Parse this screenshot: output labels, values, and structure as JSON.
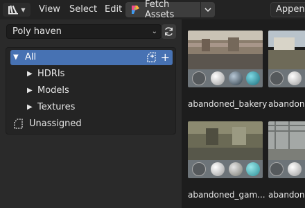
{
  "header": {
    "menus": [
      "View",
      "Select",
      "Edit"
    ],
    "fetch_label": "Fetch Assets",
    "append_label": "Append"
  },
  "sidebar": {
    "library": "Poly haven",
    "catalog": {
      "all": "All",
      "items": [
        "HDRIs",
        "Models",
        "Textures"
      ],
      "unassigned": "Unassigned"
    }
  },
  "assets": [
    {
      "name": "abandoned_bakery"
    },
    {
      "name": "abandone"
    },
    {
      "name": "abandoned_gam..."
    },
    {
      "name": "abandone"
    }
  ],
  "colors": {
    "accent": "#4772b3",
    "panel": "#2a2a2a",
    "background": "#1d1d1d"
  }
}
